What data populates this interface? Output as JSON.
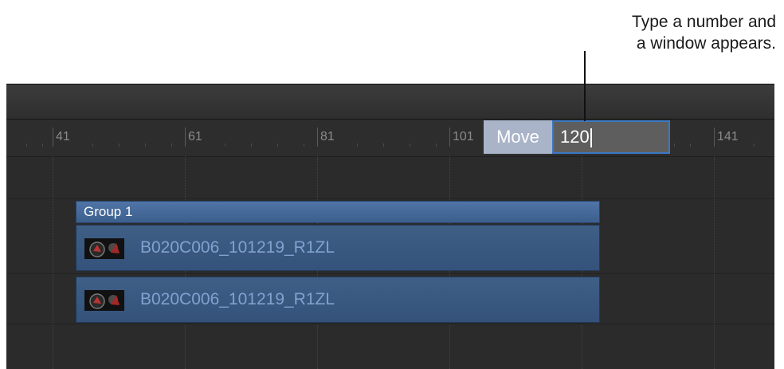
{
  "callout": {
    "line1": "Type a number and",
    "line2": "a window appears."
  },
  "ruler": {
    "labels": [
      "41",
      "61",
      "81",
      "101",
      "141"
    ]
  },
  "move_field": {
    "label": "Move",
    "value": "120"
  },
  "timeline": {
    "group_label": "Group 1",
    "clips": [
      {
        "name": "B020C006_101219_R1ZL"
      },
      {
        "name": "B020C006_101219_R1ZL"
      }
    ]
  },
  "colors": {
    "panel_bg": "#2b2b2b",
    "group_bar": "#4a6fa0",
    "clip_bg": "#3a5a82",
    "clip_text": "#7fa2cf",
    "move_label_bg": "#a9b4c8",
    "input_border": "#3b78c4"
  },
  "icons": {
    "clip_thumbnail": "video-thumbnail-icon"
  }
}
